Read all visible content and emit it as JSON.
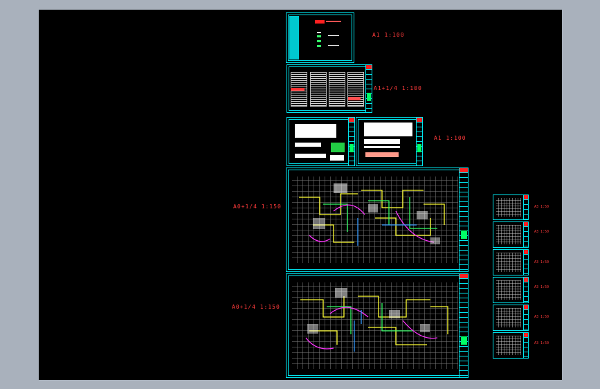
{
  "viewer": {
    "sheets": [
      {
        "id": "cover",
        "scale_label": "A1    1:100"
      },
      {
        "id": "notes",
        "scale_label": "A1+1/4   1:100"
      },
      {
        "id": "legend",
        "scale_label": "A1    1:100"
      },
      {
        "id": "plan-1",
        "scale_label": "A0+1/4   1:150"
      },
      {
        "id": "plan-2",
        "scale_label": "A0+1/4   1:150"
      }
    ],
    "detail_labels": [
      "A3   1:50",
      "A3   1:50",
      "A3   1:50",
      "A3   1:50",
      "A3   1:50",
      "A3   1:50"
    ]
  },
  "colors": {
    "background": "#a9b1bc",
    "canvas": "#000000",
    "frame": "#00e5ee",
    "label": "#ff3b3b",
    "wire_yellow": "#ffff33",
    "wire_green": "#33ff66",
    "wire_magenta": "#ff33ff",
    "wire_blue": "#3399ff"
  }
}
